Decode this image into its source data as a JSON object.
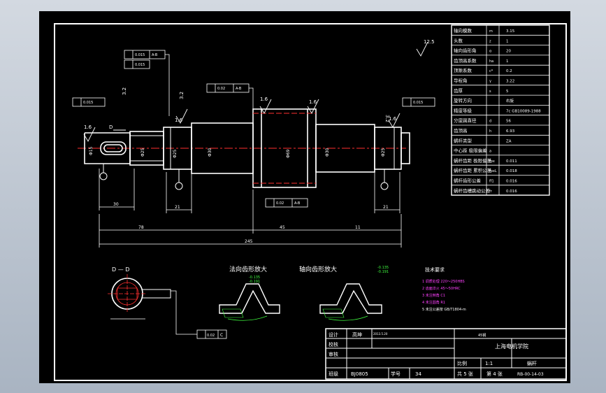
{
  "params": [
    {
      "name": "轴向模数",
      "sym": "m",
      "val": "3.15"
    },
    {
      "name": "头数",
      "sym": "z",
      "val": "1"
    },
    {
      "name": "轴向齿形角",
      "sym": "α",
      "val": "20"
    },
    {
      "name": "齿顶高系数",
      "sym": "ha",
      "val": "1"
    },
    {
      "name": "顶隙系数",
      "sym": "c*",
      "val": "0.2"
    },
    {
      "name": "导程角",
      "sym": "γ",
      "val": "3.22"
    },
    {
      "name": "齿厚",
      "sym": "s",
      "val": "5"
    },
    {
      "name": "旋转方向",
      "sym": "",
      "val": "右旋"
    },
    {
      "name": "精度等级",
      "sym": "",
      "val": "7c GB10089-1988"
    },
    {
      "name": "分度圆直径",
      "sym": "d",
      "val": "56"
    },
    {
      "name": "齿顶高",
      "sym": "h",
      "val": "6.93"
    },
    {
      "name": "蜗杆类型",
      "sym": "",
      "val": "ZA"
    },
    {
      "name": "中心距 极限偏差",
      "sym": "a",
      "val": ""
    },
    {
      "name": "蜗杆齿距 极限偏差",
      "sym": "fpx",
      "val": "0.011"
    },
    {
      "name": "蜗杆齿距 累积公差",
      "sym": "fpxL",
      "val": "0.018"
    },
    {
      "name": "蜗杆齿形公差",
      "sym": "ff1",
      "val": "0.016"
    },
    {
      "name": "蜗杆齿槽跳动公差",
      "sym": "fr",
      "val": "0.016"
    }
  ],
  "dims": {
    "d30": "30",
    "d21a": "21",
    "d21b": "21",
    "d78": "78",
    "d45": "45",
    "d11": "11",
    "d245": "245",
    "dia1": "Φ15",
    "dia2": "Φ25",
    "dia3": "Φ25",
    "dia4": "Φ30",
    "dia5": "Φ69",
    "dia6": "Φ30",
    "dia7": "Φ25",
    "dia8": "Φ15"
  },
  "roughness": {
    "r16": "1.6",
    "r32": "3.2",
    "r125": "12.5"
  },
  "tol": {
    "t1": "0.015",
    "t2": "A-B",
    "t3": "0.015",
    "t4": "0.015",
    "t5": "0.02",
    "tflat": "0.02",
    "tc": "C"
  },
  "labels": {
    "section": "D — D",
    "d_mark": "D",
    "normal_profile": "法向齿形放大",
    "axial_profile": "轴向齿形放大",
    "tol1": "-0.135",
    "tol2": "-0.191",
    "tech_title": "技术要求",
    "tech": [
      "1 调质处理 220～250HBS",
      "2 齿面淬火 45～50HRC",
      "3 未注倒角 C1",
      "4 未注圆角 R1",
      "5 未注公差按 GB/T1804-m"
    ]
  },
  "title_block": {
    "design": "设计",
    "check": "校核",
    "review": "审核",
    "class": "班级",
    "designer": "高坤",
    "date": "2013.5.20",
    "material": "45钢",
    "school": "上海电机学院",
    "scale_label": "比例",
    "scale_val": "1:1",
    "part": "蜗杆",
    "sheets": "共 5 张",
    "sheet": "第 4 张",
    "class_val": "BJ0805",
    "id_label": "学号",
    "id_val": "34",
    "code": "RB-00-14-03"
  },
  "colors": {
    "bg": "#000000",
    "line": "#ffffff",
    "center": "#ff3030",
    "dim": "#ffffff",
    "hatch": "#40ff40",
    "accent": "#ff40ff",
    "tol": "#40ff40"
  }
}
